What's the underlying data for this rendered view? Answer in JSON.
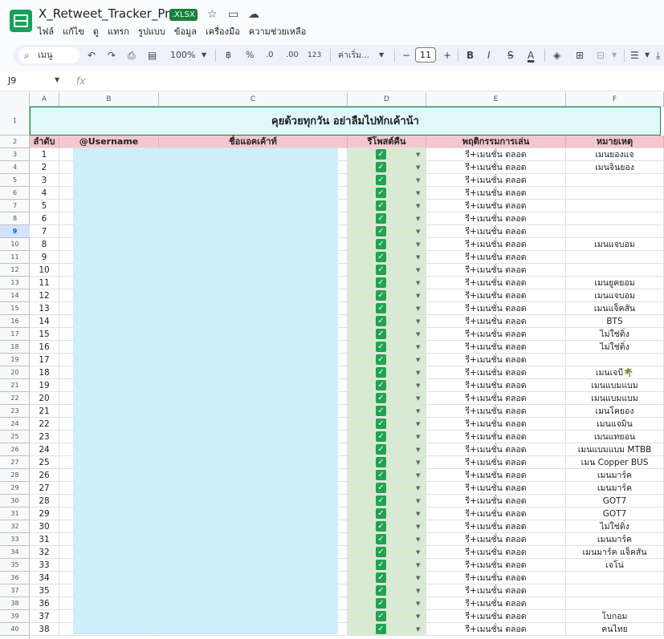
{
  "app": {
    "doc_title": "X_Retweet_Tracker_Pro",
    "badge": ".XLSX",
    "menu": [
      "ไฟล์",
      "แก้ไข",
      "ดู",
      "แทรก",
      "รูปแบบ",
      "ข้อมูล",
      "เครื่องมือ",
      "ความช่วยเหลือ"
    ]
  },
  "toolbar": {
    "search_placeholder": "เมนู",
    "zoom": "100%",
    "currency": "฿",
    "percent": "%",
    "dec_decrease": ".0",
    "dec_increase": ".00",
    "number_format": "123",
    "font": "ค่าเริ่ม...",
    "font_size": "11",
    "bold": "B",
    "italic": "I",
    "strike": "S",
    "text_color": "A"
  },
  "formula_bar": {
    "name_box": "J9",
    "fx": "fx"
  },
  "columns": [
    "A",
    "B",
    "C",
    "D",
    "E",
    "F"
  ],
  "sheet": {
    "banner": "คุยด้วยทุกวัน อย่าลืมไปทักเค้าน้า",
    "headers": {
      "no": "ลำดับ",
      "username": "@Username",
      "account": "ชื่อแอคเค้าท์",
      "retweet": "รีโพสต์คืน",
      "behavior": "พฤติกรรมการเล่น",
      "note": "หมายเหตุ"
    },
    "selected_row": 9,
    "rows": [
      {
        "r": 3,
        "no": "1",
        "behavior": "รี+เมนชั่น ตลอด",
        "note": "เมนยองแจ"
      },
      {
        "r": 4,
        "no": "2",
        "behavior": "รี+เมนชั่น ตลอด",
        "note": "เมนจินยอง"
      },
      {
        "r": 5,
        "no": "3",
        "behavior": "รี+เมนชั่น ตลอด",
        "note": ""
      },
      {
        "r": 6,
        "no": "4",
        "behavior": "รี+เมนชั่น ตลอด",
        "note": ""
      },
      {
        "r": 7,
        "no": "5",
        "behavior": "รี+เมนชั่น ตลอด",
        "note": ""
      },
      {
        "r": 8,
        "no": "6",
        "behavior": "รี+เมนชั่น ตลอด",
        "note": ""
      },
      {
        "r": 9,
        "no": "7",
        "behavior": "รี+เมนชั่น ตลอด",
        "note": ""
      },
      {
        "r": 10,
        "no": "8",
        "behavior": "รี+เมนชั่น ตลอด",
        "note": "เมนแจบอม"
      },
      {
        "r": 11,
        "no": "9",
        "behavior": "รี+เมนชั่น ตลอด",
        "note": ""
      },
      {
        "r": 12,
        "no": "10",
        "behavior": "รี+เมนชั่น ตลอด",
        "note": ""
      },
      {
        "r": 13,
        "no": "11",
        "behavior": "รี+เมนชั่น ตลอด",
        "note": "เมนยูคยอม"
      },
      {
        "r": 14,
        "no": "12",
        "behavior": "รี+เมนชั่น ตลอด",
        "note": "เมนแจบอม"
      },
      {
        "r": 15,
        "no": "13",
        "behavior": "รี+เมนชั่น ตลอด",
        "note": "เมนแจ็คสัน"
      },
      {
        "r": 16,
        "no": "14",
        "behavior": "รี+เมนชั่น ตลอด",
        "note": "BTS"
      },
      {
        "r": 17,
        "no": "15",
        "behavior": "รี+เมนชั่น ตลอด",
        "note": "ไม่ใช่ติ่ง"
      },
      {
        "r": 18,
        "no": "16",
        "behavior": "รี+เมนชั่น ตลอด",
        "note": "ไม่ใช่ติ่ง"
      },
      {
        "r": 19,
        "no": "17",
        "behavior": "รี+เมนชั่น ตลอด",
        "note": ""
      },
      {
        "r": 20,
        "no": "18",
        "behavior": "รี+เมนชั่น ตลอด",
        "note": "เมนเจบี🌴"
      },
      {
        "r": 21,
        "no": "19",
        "behavior": "รี+เมนชั่น ตลอด",
        "note": "เมนแบมแบม"
      },
      {
        "r": 22,
        "no": "20",
        "behavior": "รี+เมนชั่น ตลอด",
        "note": "เมนแบมแบม"
      },
      {
        "r": 23,
        "no": "21",
        "behavior": "รี+เมนชั่น ตลอด",
        "note": "เมนโคยอง"
      },
      {
        "r": 24,
        "no": "22",
        "behavior": "รี+เมนชั่น ตลอด",
        "note": "เมนแจมิน"
      },
      {
        "r": 25,
        "no": "23",
        "behavior": "รี+เมนชั่น ตลอด",
        "note": "เมนแทยอน"
      },
      {
        "r": 26,
        "no": "24",
        "behavior": "รี+เมนชั่น ตลอด",
        "note": "เมนแบมแบม MTBB"
      },
      {
        "r": 27,
        "no": "25",
        "behavior": "รี+เมนชั่น ตลอด",
        "note": "เมน Copper BUS"
      },
      {
        "r": 28,
        "no": "26",
        "behavior": "รี+เมนชั่น ตลอด",
        "note": "เมนมาร์ค"
      },
      {
        "r": 29,
        "no": "27",
        "behavior": "รี+เมนชั่น ตลอด",
        "note": "เมนมาร์ค"
      },
      {
        "r": 30,
        "no": "28",
        "behavior": "รี+เมนชั่น ตลอด",
        "note": "GOT7"
      },
      {
        "r": 31,
        "no": "29",
        "behavior": "รี+เมนชั่น ตลอด",
        "note": "GOT7"
      },
      {
        "r": 32,
        "no": "30",
        "behavior": "รี+เมนชั่น ตลอด",
        "note": "ไม่ใช่ติ่ง"
      },
      {
        "r": 33,
        "no": "31",
        "behavior": "รี+เมนชั่น ตลอด",
        "note": "เมนมาร์ค"
      },
      {
        "r": 34,
        "no": "32",
        "behavior": "รี+เมนชั่น ตลอด",
        "note": "เมนมาร์ค แจ็คสัน"
      },
      {
        "r": 35,
        "no": "33",
        "behavior": "รี+เมนชั่น ตลอด",
        "note": "เจโน่"
      },
      {
        "r": 36,
        "no": "34",
        "behavior": "รี+เมนชั่น ตลอด",
        "note": ""
      },
      {
        "r": 37,
        "no": "35",
        "behavior": "รี+เมนชั่น ตลอด",
        "note": ""
      },
      {
        "r": 38,
        "no": "36",
        "behavior": "รี+เมนชั่น ตลอด",
        "note": ""
      },
      {
        "r": 39,
        "no": "37",
        "behavior": "รี+เมนชั่น ตลอด",
        "note": "โบกอม"
      },
      {
        "r": 40,
        "no": "38",
        "behavior": "รี+เมนชั่น ตลอด",
        "note": "คนไทย"
      }
    ]
  },
  "colors": {
    "checkbox": "#21a350",
    "retweet_fill": "#d9ead3",
    "header_fill": "#f4c7ce",
    "banner_fill": "#e0f7fb",
    "redaction": "#cdeefc"
  }
}
